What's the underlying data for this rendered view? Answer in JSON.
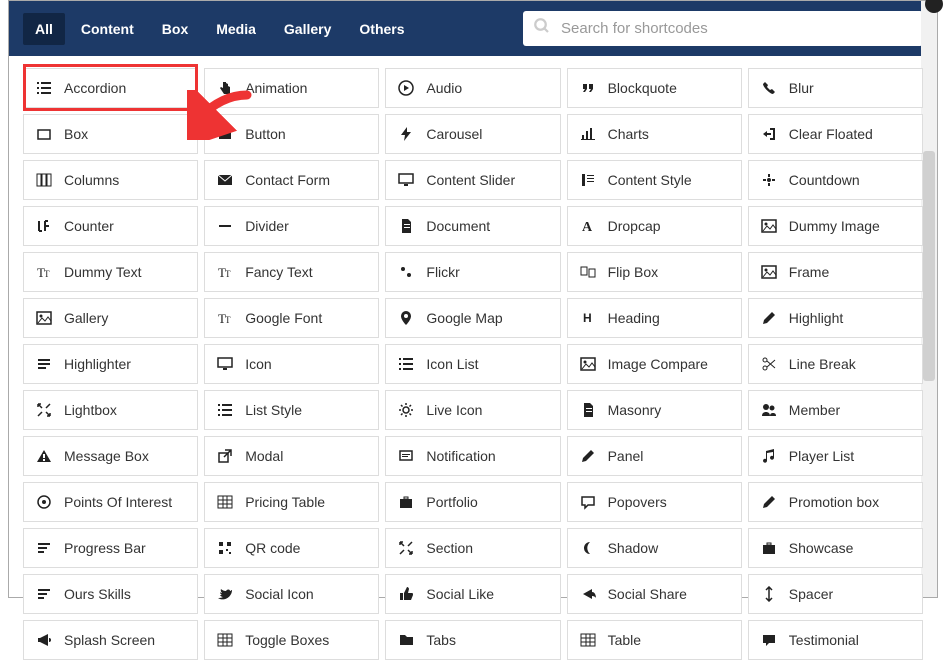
{
  "header": {
    "tabs": [
      "All",
      "Content",
      "Box",
      "Media",
      "Gallery",
      "Others"
    ],
    "active_tab_index": 0,
    "search_placeholder": "Search for shortcodes"
  },
  "shortcodes": [
    {
      "label": "Accordion",
      "icon": "list"
    },
    {
      "label": "Animation",
      "icon": "hand"
    },
    {
      "label": "Audio",
      "icon": "play"
    },
    {
      "label": "Blockquote",
      "icon": "quote"
    },
    {
      "label": "Blur",
      "icon": "phone"
    },
    {
      "label": "Box",
      "icon": "square"
    },
    {
      "label": "Button",
      "icon": "square-fill"
    },
    {
      "label": "Carousel",
      "icon": "bolt"
    },
    {
      "label": "Charts",
      "icon": "chart"
    },
    {
      "label": "Clear Floated",
      "icon": "login"
    },
    {
      "label": "Columns",
      "icon": "columns"
    },
    {
      "label": "Contact Form",
      "icon": "mail"
    },
    {
      "label": "Content Slider",
      "icon": "monitor"
    },
    {
      "label": "Content Style",
      "icon": "style"
    },
    {
      "label": "Countdown",
      "icon": "countdown"
    },
    {
      "label": "Counter",
      "icon": "counter"
    },
    {
      "label": "Divider",
      "icon": "minus"
    },
    {
      "label": "Document",
      "icon": "doc"
    },
    {
      "label": "Dropcap",
      "icon": "font"
    },
    {
      "label": "Dummy Image",
      "icon": "image"
    },
    {
      "label": "Dummy Text",
      "icon": "text"
    },
    {
      "label": "Fancy Text",
      "icon": "text"
    },
    {
      "label": "Flickr",
      "icon": "dots"
    },
    {
      "label": "Flip Box",
      "icon": "flip"
    },
    {
      "label": "Frame",
      "icon": "image"
    },
    {
      "label": "Gallery",
      "icon": "image"
    },
    {
      "label": "Google Font",
      "icon": "text"
    },
    {
      "label": "Google Map",
      "icon": "pin"
    },
    {
      "label": "Heading",
      "icon": "heading"
    },
    {
      "label": "Highlight",
      "icon": "pencil"
    },
    {
      "label": "Highlighter",
      "icon": "highlight"
    },
    {
      "label": "Icon",
      "icon": "monitor"
    },
    {
      "label": "Icon List",
      "icon": "list"
    },
    {
      "label": "Image Compare",
      "icon": "image"
    },
    {
      "label": "Line Break",
      "icon": "scissors"
    },
    {
      "label": "Lightbox",
      "icon": "expand"
    },
    {
      "label": "List Style",
      "icon": "list"
    },
    {
      "label": "Live Icon",
      "icon": "gear"
    },
    {
      "label": "Masonry",
      "icon": "doc"
    },
    {
      "label": "Member",
      "icon": "users"
    },
    {
      "label": "Message Box",
      "icon": "warning"
    },
    {
      "label": "Modal",
      "icon": "external"
    },
    {
      "label": "Notification",
      "icon": "notify"
    },
    {
      "label": "Panel",
      "icon": "pencil"
    },
    {
      "label": "Player List",
      "icon": "music"
    },
    {
      "label": "Points Of Interest",
      "icon": "target"
    },
    {
      "label": "Pricing Table",
      "icon": "table"
    },
    {
      "label": "Portfolio",
      "icon": "briefcase"
    },
    {
      "label": "Popovers",
      "icon": "comment"
    },
    {
      "label": "Promotion box",
      "icon": "pencil"
    },
    {
      "label": "Progress Bar",
      "icon": "bars"
    },
    {
      "label": "QR code",
      "icon": "qr"
    },
    {
      "label": "Section",
      "icon": "expand"
    },
    {
      "label": "Shadow",
      "icon": "moon"
    },
    {
      "label": "Showcase",
      "icon": "briefcase"
    },
    {
      "label": "Ours Skills",
      "icon": "bars"
    },
    {
      "label": "Social Icon",
      "icon": "twitter"
    },
    {
      "label": "Social Like",
      "icon": "thumb"
    },
    {
      "label": "Social Share",
      "icon": "share"
    },
    {
      "label": "Spacer",
      "icon": "spacer"
    },
    {
      "label": "Splash Screen",
      "icon": "bullhorn"
    },
    {
      "label": "Toggle Boxes",
      "icon": "table"
    },
    {
      "label": "Tabs",
      "icon": "folder"
    },
    {
      "label": "Table",
      "icon": "table"
    },
    {
      "label": "Testimonial",
      "icon": "comment-fill"
    }
  ],
  "annotations": {
    "highlight_item_index": 0,
    "arrow_points_to": "gallery-tab-from-accordion"
  }
}
